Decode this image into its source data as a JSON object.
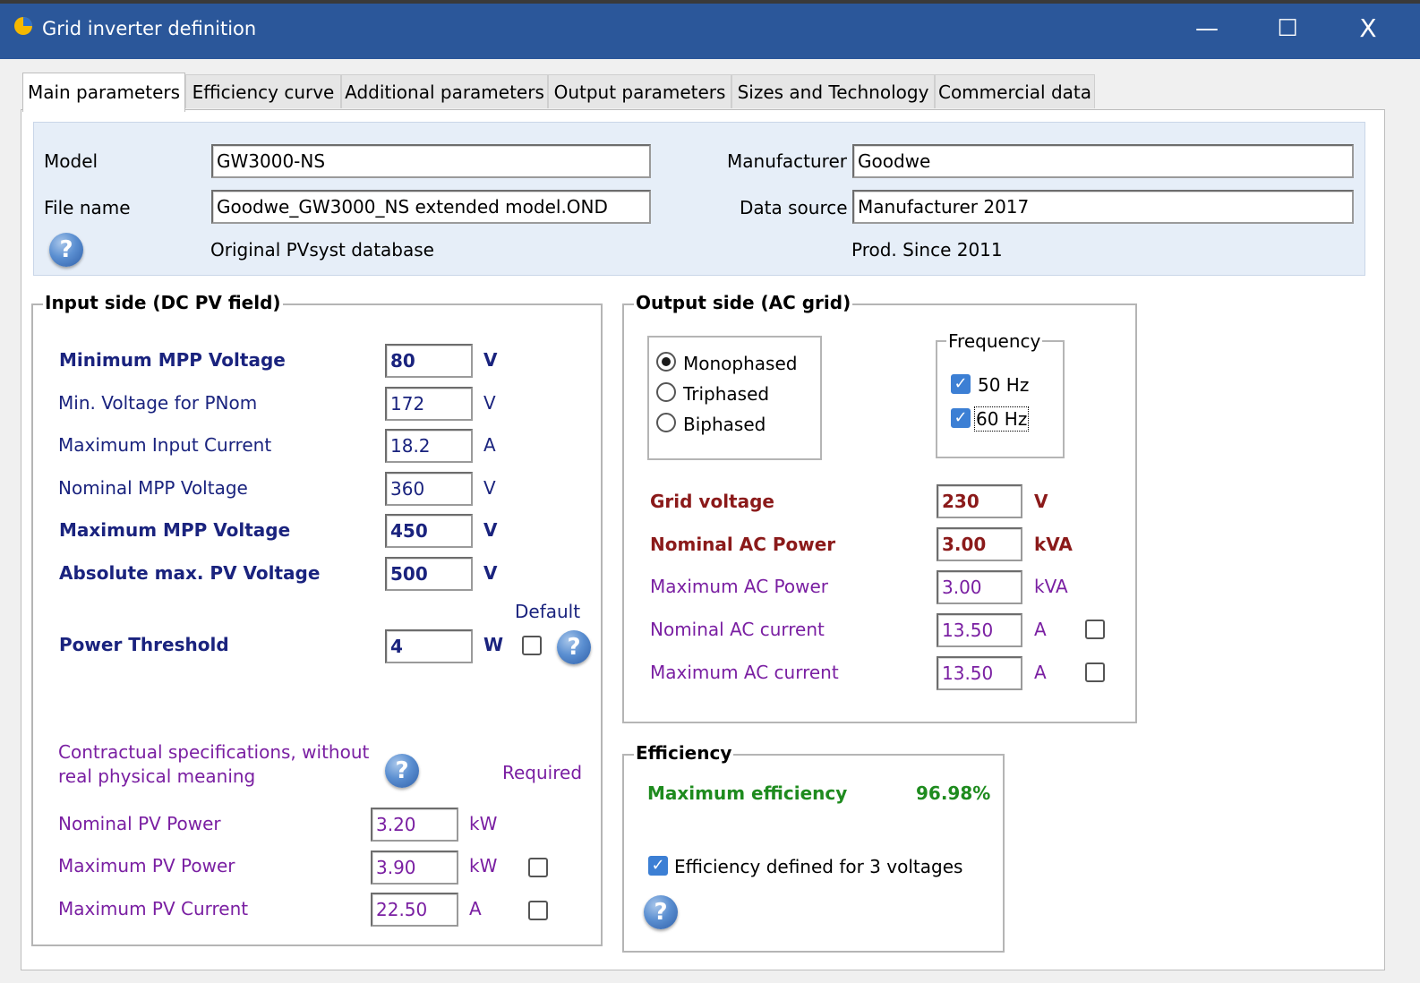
{
  "window": {
    "title": "Grid inverter definition",
    "minimize_glyph": "—",
    "maximize_glyph": "☐",
    "close_glyph": "X"
  },
  "tabs": [
    {
      "label": "Main parameters",
      "active": true
    },
    {
      "label": "Efficiency curve",
      "active": false
    },
    {
      "label": "Additional parameters",
      "active": false
    },
    {
      "label": "Output parameters",
      "active": false
    },
    {
      "label": "Sizes and Technology",
      "active": false
    },
    {
      "label": "Commercial data",
      "active": false
    }
  ],
  "header": {
    "model_label": "Model",
    "model_value": "GW3000-NS",
    "file_label": "File name",
    "file_value": "Goodwe_GW3000_NS extended model.OND",
    "database_note": "Original PVsyst database",
    "manufacturer_label": "Manufacturer",
    "manufacturer_value": "Goodwe",
    "source_label": "Data source",
    "source_value": "Manufacturer 2017",
    "prod_since": "Prod. Since 2011"
  },
  "input_side": {
    "title": "Input side (DC PV field)",
    "rows": [
      {
        "label": "Minimum MPP Voltage",
        "value": "80",
        "unit": "V"
      },
      {
        "label": "Min. Voltage for PNom",
        "value": "172",
        "unit": "V"
      },
      {
        "label": "Maximum Input Current",
        "value": "18.2",
        "unit": "A"
      },
      {
        "label": "Nominal MPP Voltage",
        "value": "360",
        "unit": "V"
      },
      {
        "label": "Maximum MPP Voltage",
        "value": "450",
        "unit": "V"
      },
      {
        "label": "Absolute max. PV Voltage",
        "value": "500",
        "unit": "V"
      }
    ],
    "default_label": "Default",
    "power_threshold": {
      "label": "Power Threshold",
      "value": "4",
      "unit": "W",
      "default_checked": false
    },
    "contractual_note": "Contractual specifications, without\nreal physical meaning",
    "required_label": "Required",
    "contractual_rows": [
      {
        "label": "Nominal PV Power",
        "value": "3.20",
        "unit": "kW"
      },
      {
        "label": "Maximum PV Power",
        "value": "3.90",
        "unit": "kW",
        "checked": false
      },
      {
        "label": "Maximum PV Current",
        "value": "22.50",
        "unit": "A",
        "checked": false
      }
    ]
  },
  "output_side": {
    "title": "Output side (AC grid)",
    "phases": [
      {
        "label": "Monophased",
        "selected": true
      },
      {
        "label": "Triphased",
        "selected": false
      },
      {
        "label": "Biphased",
        "selected": false
      }
    ],
    "frequency": {
      "title": "Frequency",
      "options": [
        {
          "label": "50 Hz",
          "checked": true
        },
        {
          "label": "60 Hz",
          "checked": true
        }
      ]
    },
    "rows": [
      {
        "label": "Grid voltage",
        "value": "230",
        "unit": "V"
      },
      {
        "label": "Nominal AC Power",
        "value": "3.00",
        "unit": "kVA"
      },
      {
        "label": "Maximum AC Power",
        "value": "3.00",
        "unit": "kVA"
      },
      {
        "label": "Nominal AC current",
        "value": "13.50",
        "unit": "A",
        "checked": false
      },
      {
        "label": "Maximum AC current",
        "value": "13.50",
        "unit": "A",
        "checked": false
      }
    ]
  },
  "efficiency": {
    "title": "Efficiency",
    "max_label": "Maximum efficiency",
    "max_value": "96.98%",
    "three_voltages_label": "Efficiency defined for 3 voltages",
    "three_voltages_checked": true
  },
  "icons": {
    "help": "?",
    "check": "✓"
  },
  "colors": {
    "titlebar": "#2b579a",
    "navy_label": "#1a237e",
    "purple_label": "#7a1fa2",
    "red_label": "#8b1a1a",
    "green_label": "#1e8b1e"
  }
}
